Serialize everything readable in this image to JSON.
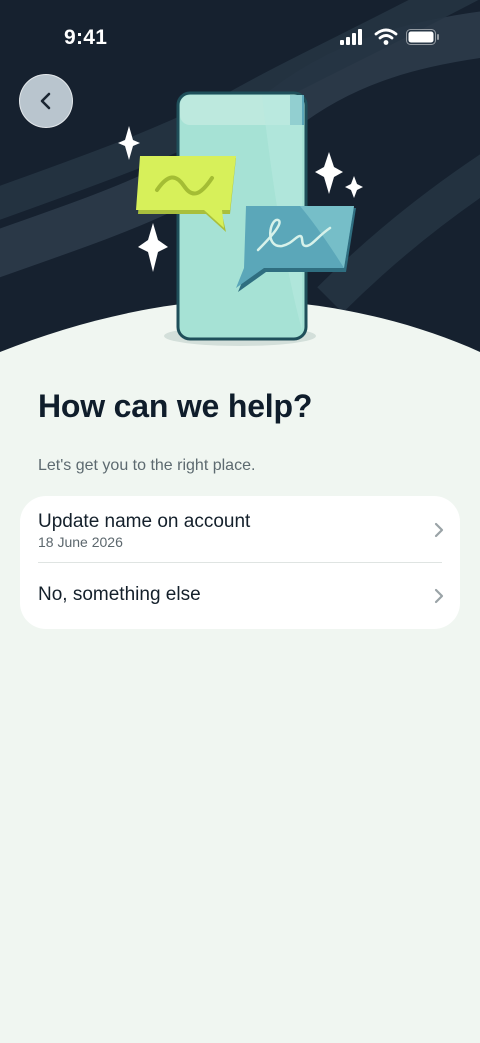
{
  "status_bar": {
    "time": "9:41"
  },
  "header": {
    "back_icon": "chevron-left-icon"
  },
  "main": {
    "title": "How can we help?",
    "subtitle": "Let's get you to the right place."
  },
  "options": [
    {
      "label": "Update name on account",
      "detail": "18 June 2026"
    },
    {
      "label": "No, something else"
    }
  ],
  "colors": {
    "hero_bg": "#16212f",
    "page_bg": "#f0f6f1",
    "card_bg": "#ffffff",
    "title": "#0f1d2b",
    "phone": "#a6e2d5",
    "bubble_lime": "#d7f05a",
    "bubble_teal": "#5ba7b9"
  }
}
